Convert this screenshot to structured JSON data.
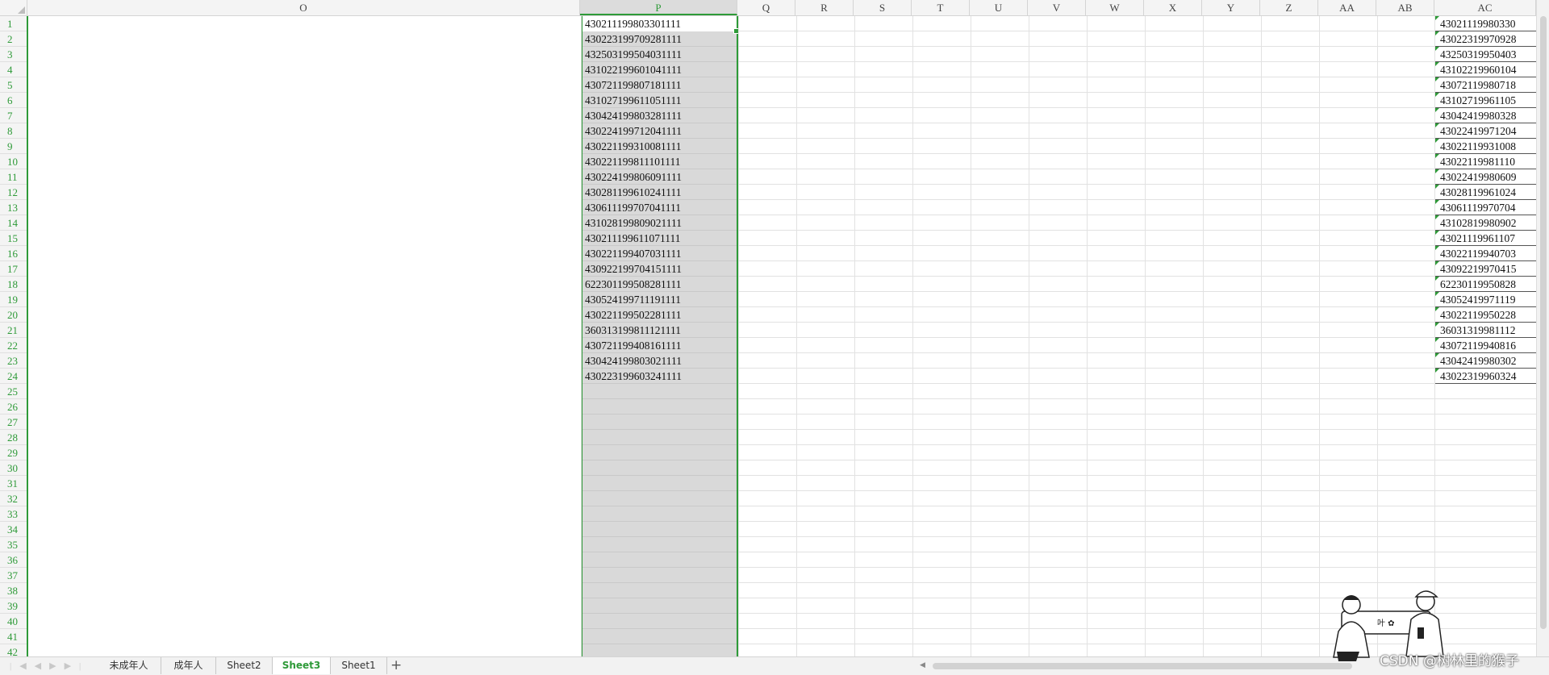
{
  "columns": [
    "O",
    "P",
    "Q",
    "R",
    "S",
    "T",
    "U",
    "V",
    "W",
    "X",
    "Y",
    "Z",
    "AA",
    "AB",
    "AC"
  ],
  "selected_column": "P",
  "rows": [
    "1",
    "2",
    "3",
    "4",
    "5",
    "6",
    "7",
    "8",
    "9",
    "10",
    "11",
    "12",
    "13",
    "14",
    "15",
    "16",
    "17",
    "18",
    "19",
    "20",
    "21",
    "22",
    "23",
    "24",
    "25",
    "26",
    "27",
    "28",
    "29",
    "30",
    "31",
    "32",
    "33",
    "34",
    "35",
    "36",
    "37",
    "38",
    "39",
    "40",
    "41",
    "42"
  ],
  "column_p_values": [
    "430211199803301111",
    "430223199709281111",
    "432503199504031111",
    "431022199601041111",
    "430721199807181111",
    "431027199611051111",
    "430424199803281111",
    "430224199712041111",
    "430221199310081111",
    "430221199811101111",
    "430224199806091111",
    "430281199610241111",
    "430611199707041111",
    "431028199809021111",
    "430211199611071111",
    "430221199407031111",
    "430922199704151111",
    "622301199508281111",
    "430524199711191111",
    "430221199502281111",
    "360313199811121111",
    "430721199408161111",
    "430424199803021111",
    "430223199603241111"
  ],
  "column_ac_visible": [
    "43021119980330",
    "43022319970928",
    "43250319950403",
    "43102219960104",
    "43072119980718",
    "43102719961105",
    "43042419980328",
    "43022419971204",
    "43022119931008",
    "43022119981110",
    "43022419980609",
    "43028119961024",
    "43061119970704",
    "43102819980902",
    "43021119961107",
    "43022119940703",
    "43092219970415",
    "62230119950828",
    "43052419971119",
    "43022119950228",
    "36031319981112",
    "43072119940816",
    "43042419980302",
    "43022319960324"
  ],
  "sheet_tabs": [
    "未成年人",
    "成年人",
    "Sheet2",
    "Sheet3",
    "Sheet1"
  ],
  "active_tab": "Sheet3",
  "add_tab_label": "+",
  "watermark": "CSDN @树林里的猴子",
  "colors": {
    "accent": "#2e9a38",
    "selection_fill": "#d9d9d9",
    "grid": "#e2e2e2"
  },
  "icons": {
    "add_sheet": "plus-icon",
    "nav": "sheet-nav-arrows-icon"
  }
}
